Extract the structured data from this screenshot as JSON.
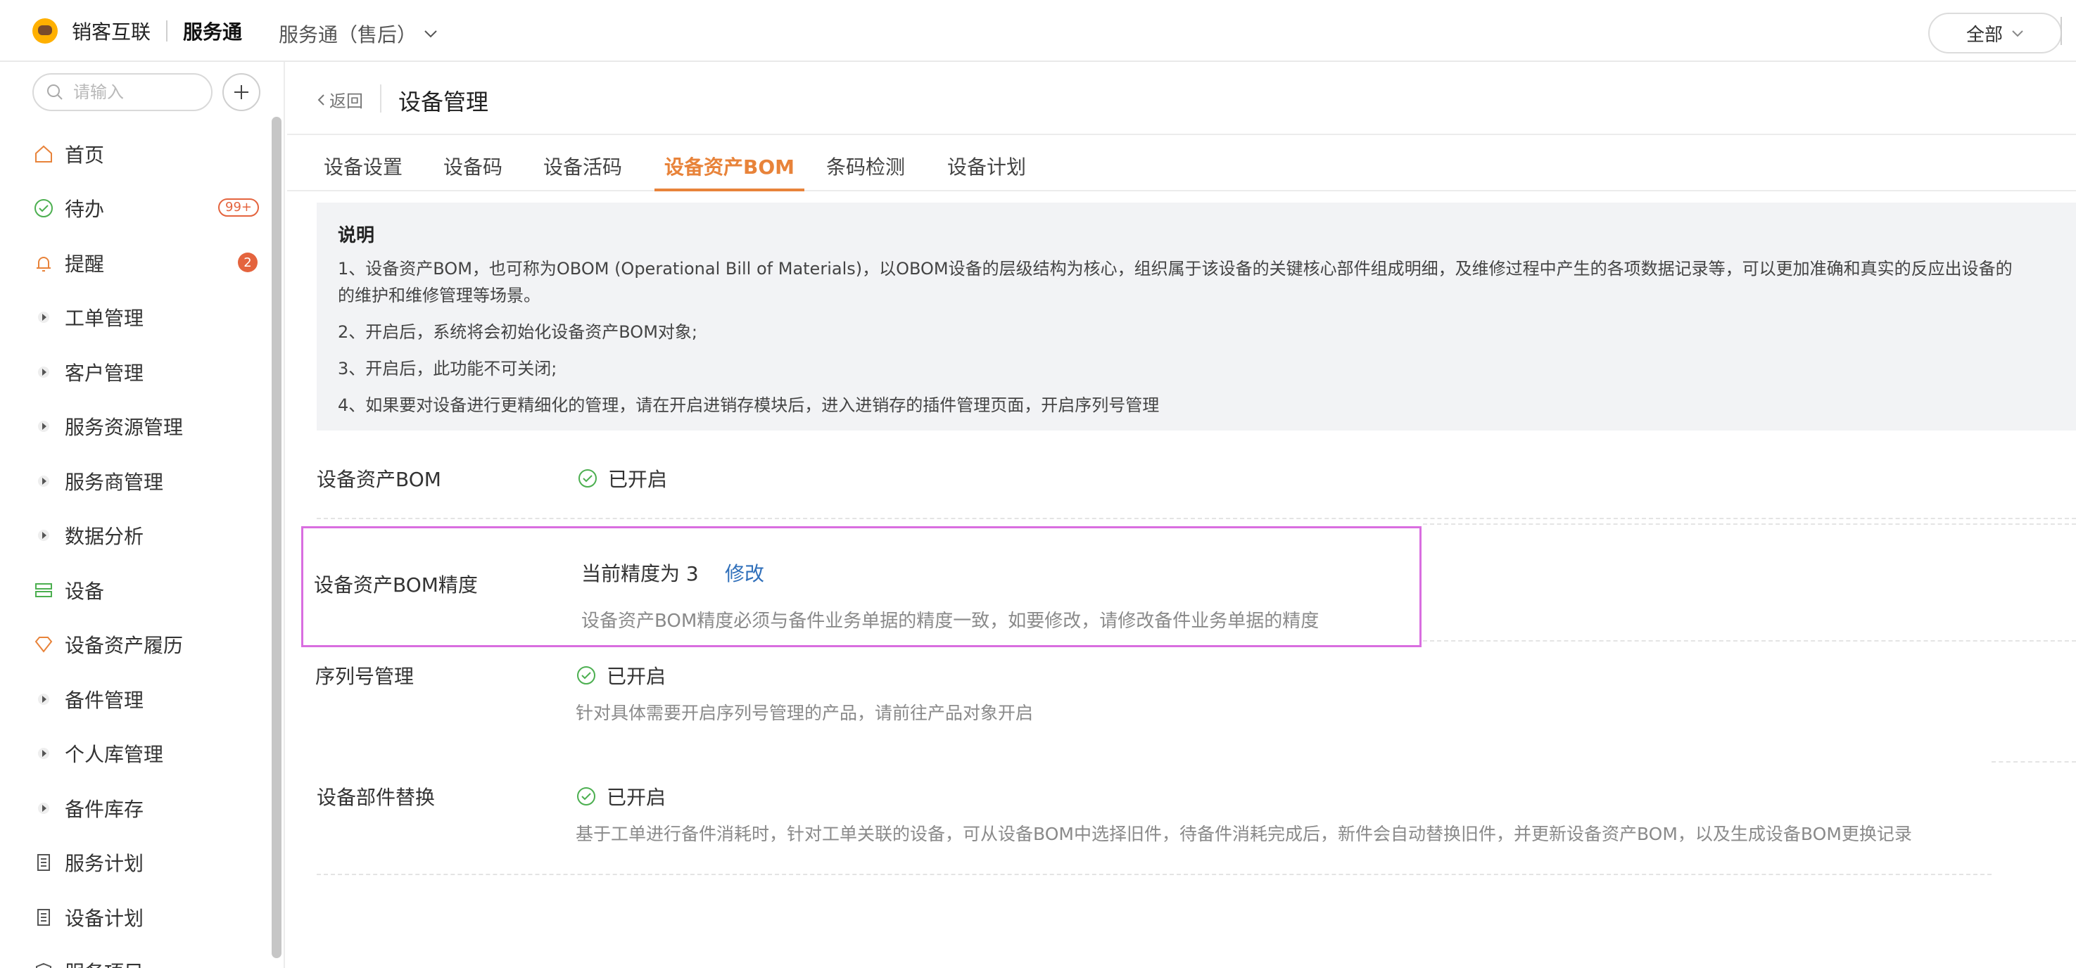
{
  "header": {
    "brand_name": "销客互联",
    "app_name": "服务通",
    "app_switch": "服务通（售后）",
    "scope": "全部"
  },
  "sidebar": {
    "search_placeholder": "请输入",
    "items": [
      {
        "label": "首页",
        "icon": "home-icon"
      },
      {
        "label": "待办",
        "icon": "check-circle-icon",
        "badge": "99+"
      },
      {
        "label": "提醒",
        "icon": "bell-icon",
        "badge": "2"
      },
      {
        "label": "工单管理",
        "icon": "caret-right-icon"
      },
      {
        "label": "客户管理",
        "icon": "caret-right-icon"
      },
      {
        "label": "服务资源管理",
        "icon": "caret-right-icon"
      },
      {
        "label": "服务商管理",
        "icon": "caret-right-icon"
      },
      {
        "label": "数据分析",
        "icon": "caret-right-icon"
      },
      {
        "label": "设备",
        "icon": "server-icon"
      },
      {
        "label": "设备资产履历",
        "icon": "diamond-icon"
      },
      {
        "label": "备件管理",
        "icon": "caret-right-icon"
      },
      {
        "label": "个人库管理",
        "icon": "caret-right-icon"
      },
      {
        "label": "备件库存",
        "icon": "caret-right-icon"
      },
      {
        "label": "服务计划",
        "icon": "document-icon"
      },
      {
        "label": "设备计划",
        "icon": "document-icon"
      },
      {
        "label": "服务项目",
        "icon": "shield-icon"
      }
    ],
    "colors": {
      "icon": "#e8833a",
      "check": "#4caf50",
      "badge": "#e4643e",
      "server": "#4caf50"
    }
  },
  "page": {
    "back": "返回",
    "title": "设备管理",
    "tabs": [
      "设备设置",
      "设备码",
      "设备活码",
      "设备资产BOM",
      "条码检测",
      "设备计划"
    ],
    "active_tab": "设备资产BOM"
  },
  "notice": {
    "title": "说明",
    "lines": [
      "1、设备资产BOM，也可称为OBOM (Operational Bill of Materials)，以OBOM设备的层级结构为核心，组织属于该设备的关键核心部件组成明细，及维修过程中产生的各项数据记录等，可以更加准确和真实的反应出设备的",
      "的维护和维修管理等场景。",
      "2、开启后，系统将会初始化设备资产BOM对象;",
      "3、开启后，此功能不可关闭;",
      "4、如果要对设备进行更精细化的管理，请在开启进销存模块后，进入进销存的插件管理页面，开启序列号管理"
    ]
  },
  "settings": {
    "bom": {
      "label": "设备资产BOM",
      "status": "已开启"
    },
    "precision": {
      "label": "设备资产BOM精度",
      "value": "当前精度为 3",
      "action": "修改",
      "desc": "设备资产BOM精度必须与备件业务单据的精度一致，如要修改，请修改备件业务单据的精度"
    },
    "serial": {
      "label": "序列号管理",
      "status": "已开启",
      "desc": "针对具体需要开启序列号管理的产品，请前往产品对象开启"
    },
    "replace": {
      "label": "设备部件替换",
      "status": "已开启",
      "desc": "基于工单进行备件消耗时，针对工单关联的设备，可从设备BOM中选择旧件，待备件消耗完成后，新件会自动替换旧件，并更新设备资产BOM，以及生成设备BOM更换记录"
    }
  },
  "colors": {
    "accent": "#e8833a",
    "link": "#2f6fba",
    "highlight": "#d96ee0",
    "success": "#4caf50"
  }
}
